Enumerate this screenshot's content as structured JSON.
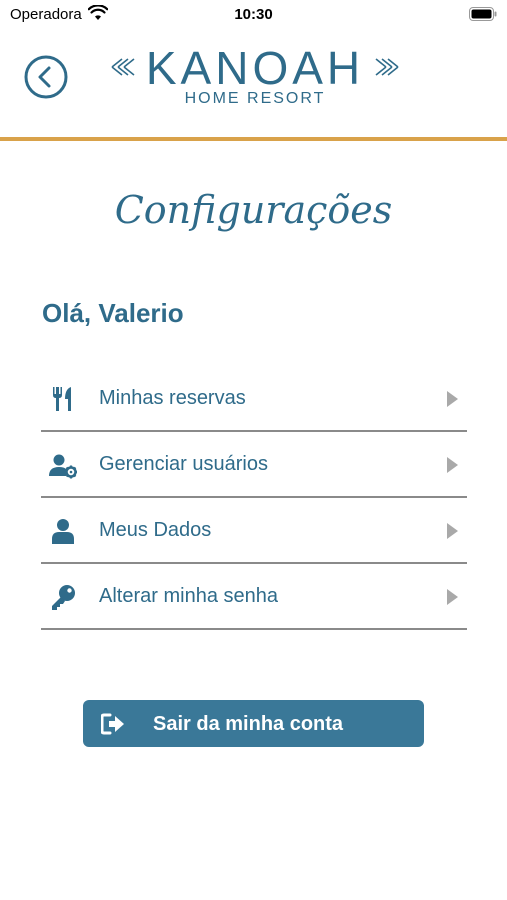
{
  "status_bar": {
    "carrier": "Operadora",
    "time": "10:30"
  },
  "header": {
    "logo_title": "KANOAH",
    "logo_subtitle": "HOME RESORT",
    "accent_color": "#d9a24a",
    "brand_color": "#2f6b8a"
  },
  "page": {
    "title": "Configurações",
    "greeting": "Olá, Valerio"
  },
  "menu": {
    "items": [
      {
        "label": "Minhas reservas",
        "icon": "utensils-icon"
      },
      {
        "label": "Gerenciar usuários",
        "icon": "user-gear-icon"
      },
      {
        "label": "Meus Dados",
        "icon": "user-icon"
      },
      {
        "label": "Alterar minha senha",
        "icon": "key-icon"
      }
    ]
  },
  "logout": {
    "label": "Sair da minha conta",
    "icon": "sign-out-icon",
    "color": "#3a7898"
  }
}
